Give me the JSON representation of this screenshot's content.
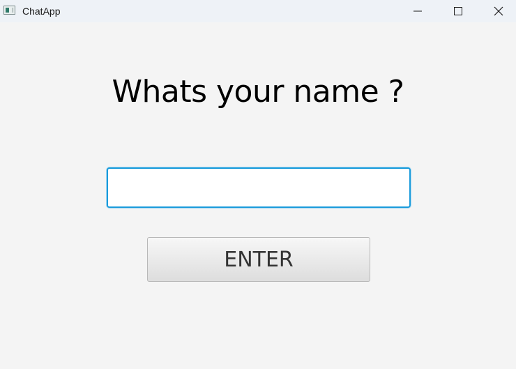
{
  "window": {
    "title": "ChatApp"
  },
  "titlebar_icons": {
    "app": "app-window-icon",
    "minimize": "minimize-icon",
    "maximize": "maximize-icon",
    "close": "close-icon"
  },
  "main": {
    "prompt": "Whats your name ?",
    "name_input_value": "",
    "enter_label": "ENTER"
  },
  "colors": {
    "input_focus_border": "#1a9bdb",
    "background": "#f4f4f4",
    "titlebar": "#eef2f7"
  }
}
